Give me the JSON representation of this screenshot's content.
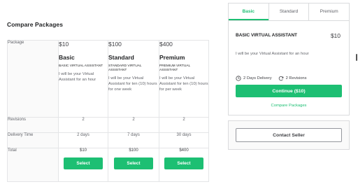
{
  "compare": {
    "title": "Compare Packages",
    "row_labels": {
      "package": "Package",
      "revisions": "Revisions",
      "delivery": "Delivery Time",
      "total": "Total"
    },
    "packages": [
      {
        "price": "$10",
        "name": "Basic",
        "desc": "BASIC VIRTUAL ASSISTANT",
        "detail": "I will be your Virtual Assistant for an hour",
        "revisions": "2",
        "delivery": "2 days",
        "total": "$10",
        "select_label": "Select"
      },
      {
        "price": "$100",
        "name": "Standard",
        "desc": "STANDARD VIRTUAL ASSISTANT",
        "detail": "I will be your Virtual Assistant for ten (10) hours for one week",
        "revisions": "2",
        "delivery": "7 days",
        "total": "$100",
        "select_label": "Select"
      },
      {
        "price": "$400",
        "name": "Premium",
        "desc": "PREMIUM VIRTUAL ASSISTANT",
        "detail": "I will be your Virtual Assistant for ten (10) hours for per week",
        "revisions": "2",
        "delivery": "30 days",
        "total": "$400",
        "select_label": "Select"
      }
    ]
  },
  "sidepanel": {
    "tabs": [
      {
        "label": "Basic",
        "active": true
      },
      {
        "label": "Standard",
        "active": false
      },
      {
        "label": "Premium",
        "active": false
      }
    ],
    "title": "BASIC VIRTUAL ASSISTANT",
    "price": "$10",
    "description": "I will be your Virtual Assistant for an hour",
    "delivery": "2 Days Delivery",
    "revisions": "2 Revisions",
    "continue_label": "Continue ($10)",
    "compare_link": "Compare Packages",
    "contact_label": "Contact Seller"
  },
  "icons": {
    "delivery": "clock-icon",
    "revisions": "refresh-icon"
  },
  "colors": {
    "accent": "#1dbf73",
    "text": "#404145",
    "muted": "#62646a",
    "border": "#e4e5e7"
  }
}
